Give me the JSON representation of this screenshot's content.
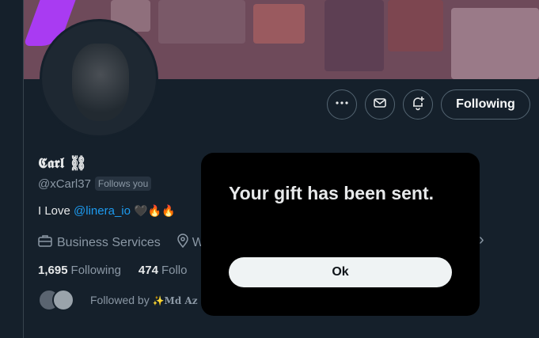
{
  "profile": {
    "name": "𝕮𝖆𝖗𝖑 ⛓",
    "handle": "@xCarl37",
    "follows_you": "Follows you",
    "bio_prefix": "I Love ",
    "bio_mention": "@linera_io",
    "bio_emojis": "🖤🔥🔥",
    "category": "Business Services",
    "location_partial": "W",
    "following_count": "1,695",
    "following_label": "Following",
    "followers_count": "474",
    "followers_label_partial": "Follo",
    "followed_by_label": "Followed by ",
    "followed_by_name_partial": "✨Md Az"
  },
  "actions": {
    "more_icon": "more-dots-icon",
    "message_icon": "envelope-icon",
    "notify_icon": "bell-plus-icon",
    "follow_label": "Following"
  },
  "dialog": {
    "message": "Your gift has been sent.",
    "ok_label": "Ok"
  },
  "colors": {
    "background": "#15202b",
    "accent_link": "#1d9bf0",
    "modal_bg": "#000000",
    "ok_button_bg": "#eff3f4"
  }
}
